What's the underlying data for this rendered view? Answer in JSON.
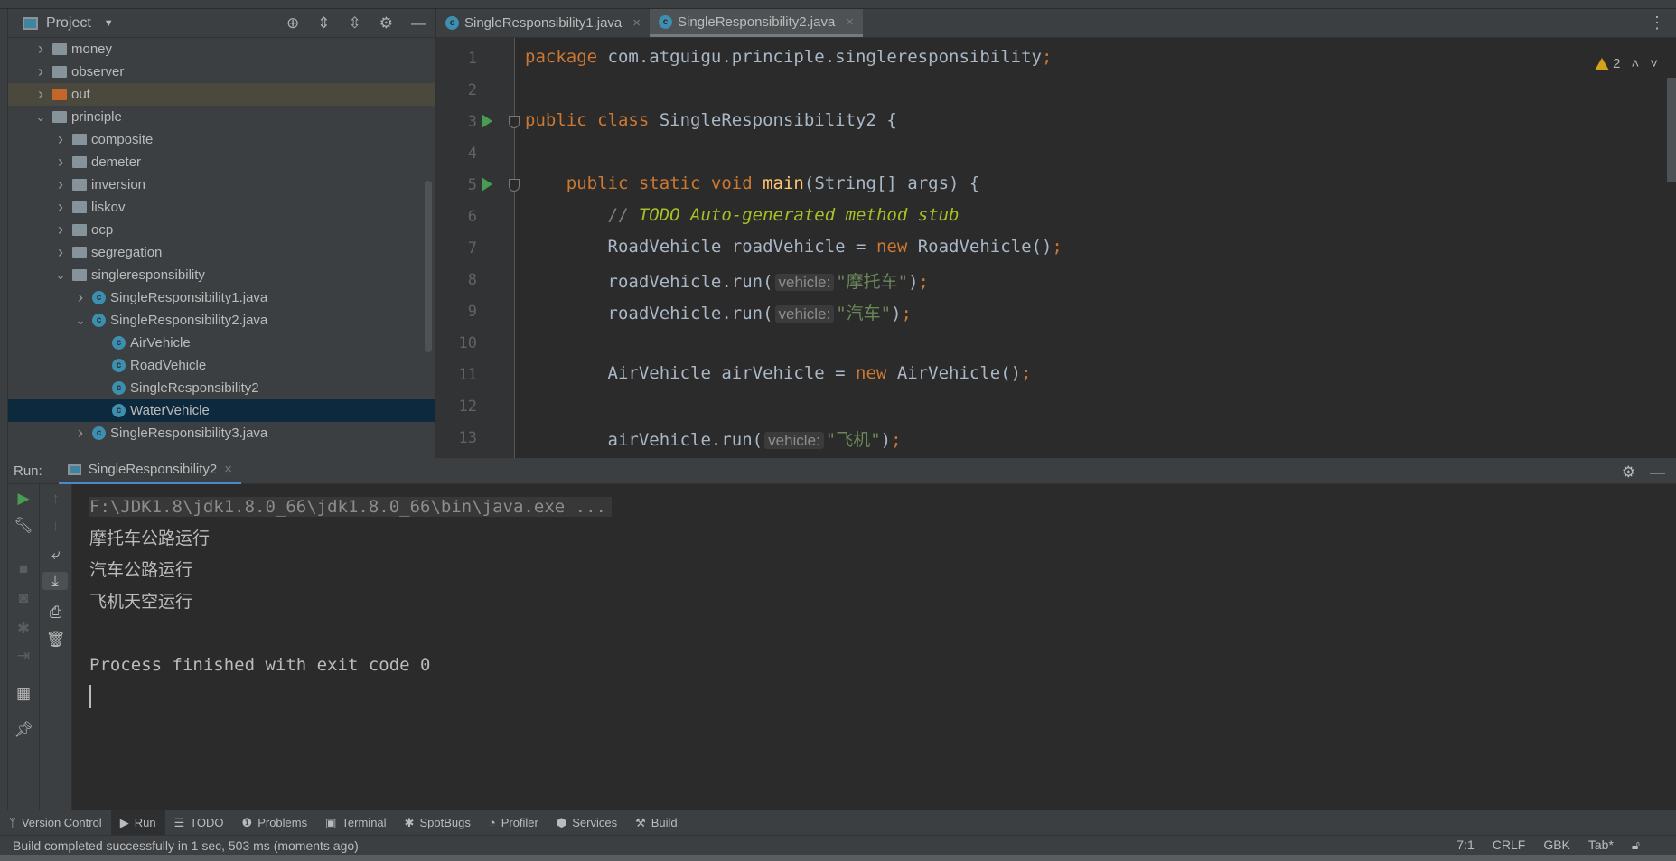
{
  "project": {
    "title": "Project",
    "tree": [
      {
        "label": "money",
        "level": 0,
        "icon": "folder",
        "chev": "›"
      },
      {
        "label": "observer",
        "level": 0,
        "icon": "folder",
        "chev": "›"
      },
      {
        "label": "out",
        "level": 0,
        "icon": "folder-orange",
        "chev": "›",
        "highlight": true
      },
      {
        "label": "principle",
        "level": 0,
        "icon": "folder",
        "chev": "⌄"
      },
      {
        "label": "composite",
        "level": 1,
        "icon": "folder",
        "chev": "›"
      },
      {
        "label": "demeter",
        "level": 1,
        "icon": "folder",
        "chev": "›"
      },
      {
        "label": "inversion",
        "level": 1,
        "icon": "folder",
        "chev": "›"
      },
      {
        "label": "liskov",
        "level": 1,
        "icon": "folder",
        "chev": "›"
      },
      {
        "label": "ocp",
        "level": 1,
        "icon": "folder",
        "chev": "›"
      },
      {
        "label": "segregation",
        "level": 1,
        "icon": "folder",
        "chev": "›"
      },
      {
        "label": "singleresponsibility",
        "level": 1,
        "icon": "folder",
        "chev": "⌄"
      },
      {
        "label": "SingleResponsibility1.java",
        "level": 2,
        "icon": "class",
        "chev": "›"
      },
      {
        "label": "SingleResponsibility2.java",
        "level": 2,
        "icon": "class",
        "chev": "⌄"
      },
      {
        "label": "AirVehicle",
        "level": 3,
        "icon": "class",
        "chev": ""
      },
      {
        "label": "RoadVehicle",
        "level": 3,
        "icon": "class",
        "chev": ""
      },
      {
        "label": "SingleResponsibility2",
        "level": 3,
        "icon": "class",
        "chev": ""
      },
      {
        "label": "WaterVehicle",
        "level": 3,
        "icon": "class",
        "chev": "",
        "selected": true
      },
      {
        "label": "SingleResponsibility3.java",
        "level": 2,
        "icon": "class",
        "chev": "›"
      }
    ]
  },
  "editor": {
    "tabs": [
      {
        "label": "SingleResponsibility1.java",
        "active": false
      },
      {
        "label": "SingleResponsibility2.java",
        "active": true
      }
    ],
    "warnings": "2",
    "lines": [
      {
        "n": "1",
        "tokens": [
          [
            "kw",
            "package "
          ],
          [
            "",
            "com.atguigu.principle.singleresponsibility"
          ],
          [
            "kw",
            ";"
          ]
        ]
      },
      {
        "n": "2",
        "tokens": []
      },
      {
        "n": "3",
        "run": true,
        "tokens": [
          [
            "kw",
            "public class "
          ],
          [
            "",
            "SingleResponsibility2 {"
          ]
        ]
      },
      {
        "n": "4",
        "tokens": []
      },
      {
        "n": "5",
        "run": true,
        "tokens": [
          [
            "",
            "    "
          ],
          [
            "kw",
            "public static void "
          ],
          [
            "mth",
            "main"
          ],
          [
            "",
            "(String[] args) {"
          ]
        ]
      },
      {
        "n": "6",
        "tokens": [
          [
            "",
            "        "
          ],
          [
            "cm",
            "// "
          ],
          [
            "todo",
            "TODO Auto-generated method stub"
          ]
        ]
      },
      {
        "n": "7",
        "tokens": [
          [
            "",
            "        RoadVehicle roadVehicle = "
          ],
          [
            "kw",
            "new "
          ],
          [
            "",
            "RoadVehicle()"
          ],
          [
            "kw",
            ";"
          ]
        ]
      },
      {
        "n": "8",
        "tokens": [
          [
            "",
            "        roadVehicle.run("
          ],
          [
            "hint",
            "vehicle:"
          ],
          [
            "str",
            "\"摩托车\""
          ],
          [
            "",
            ")"
          ],
          [
            "kw",
            ";"
          ]
        ]
      },
      {
        "n": "9",
        "tokens": [
          [
            "",
            "        roadVehicle.run("
          ],
          [
            "hint",
            "vehicle:"
          ],
          [
            "str",
            "\"汽车\""
          ],
          [
            "",
            ")"
          ],
          [
            "kw",
            ";"
          ]
        ]
      },
      {
        "n": "10",
        "tokens": []
      },
      {
        "n": "11",
        "tokens": [
          [
            "",
            "        AirVehicle airVehicle = "
          ],
          [
            "kw",
            "new "
          ],
          [
            "",
            "AirVehicle()"
          ],
          [
            "kw",
            ";"
          ]
        ]
      },
      {
        "n": "12",
        "tokens": []
      },
      {
        "n": "13",
        "tokens": [
          [
            "",
            "        airVehicle.run("
          ],
          [
            "hint",
            "vehicle:"
          ],
          [
            "str",
            "\"飞机\""
          ],
          [
            "",
            ")"
          ],
          [
            "kw",
            ";"
          ]
        ]
      }
    ]
  },
  "run": {
    "label": "Run:",
    "tab": "SingleResponsibility2",
    "command": "F:\\JDK1.8\\jdk1.8.0_66\\jdk1.8.0_66\\bin\\java.exe ...",
    "output": [
      "摩托车公路运行",
      "汽车公路运行",
      "飞机天空运行",
      "",
      "Process finished with exit code 0"
    ]
  },
  "toolwindows": [
    {
      "icon": "branch-icon",
      "glyph": "ᛘ",
      "label": "Version Control"
    },
    {
      "icon": "run-icon",
      "glyph": "▶",
      "label": "Run",
      "active": true
    },
    {
      "icon": "list-icon",
      "glyph": "☰",
      "label": "TODO"
    },
    {
      "icon": "problems-icon",
      "glyph": "❶",
      "label": "Problems"
    },
    {
      "icon": "terminal-icon",
      "glyph": "▣",
      "label": "Terminal"
    },
    {
      "icon": "bug-icon",
      "glyph": "✱",
      "label": "SpotBugs"
    },
    {
      "icon": "profiler-icon",
      "glyph": "◔",
      "label": "Profiler"
    },
    {
      "icon": "services-icon",
      "glyph": "⬢",
      "label": "Services"
    },
    {
      "icon": "hammer-icon",
      "glyph": "⚒",
      "label": "Build"
    }
  ],
  "status": {
    "message": "Build completed successfully in 1 sec, 503 ms (moments ago)",
    "position": "7:1",
    "line_sep": "CRLF",
    "encoding": "GBK",
    "indent": "Tab*"
  }
}
